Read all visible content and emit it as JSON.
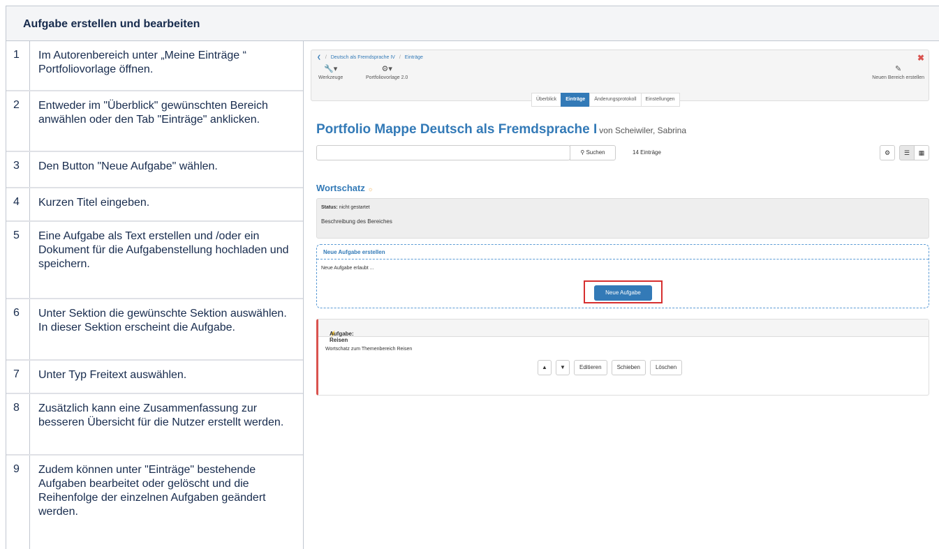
{
  "doc": {
    "heading": "Aufgabe erstellen und bearbeiten",
    "steps": [
      {
        "num": "1",
        "text": "Im Autorenbereich unter „Meine Einträge “ Portfoliovorlage öffnen."
      },
      {
        "num": "2",
        "text": "Entweder im \"Überblick\" gewünschten Bereich anwählen oder den Tab \"Einträge\" anklicken."
      },
      {
        "num": "3",
        "text": "Den Button \"Neue Aufgabe\" wählen."
      },
      {
        "num": "4",
        "text": "Kurzen Titel eingeben."
      },
      {
        "num": "5",
        "text": "Eine Aufgabe als Text erstellen und /oder ein Dokument für die Aufgabenstellung hochladen und speichern."
      },
      {
        "num": "6",
        "text": "Unter Sektion die gewünschte Sektion auswählen. In dieser Sektion erscheint die Aufgabe."
      },
      {
        "num": "7",
        "text": "Unter Typ Freitext auswählen."
      },
      {
        "num": "8",
        "text": "Zusätzlich kann eine Zusammenfassung zur besseren Übersicht für die Nutzer erstellt werden."
      },
      {
        "num": "9",
        "text": "Zudem können unter \"Einträge\" bestehende Aufgaben bearbeitet oder gelöscht und die Reihenfolge der einzelnen Aufgaben geändert werden."
      }
    ]
  },
  "app": {
    "breadcrumb": [
      "Deutsch als Fremdsprache IV",
      "Einträge"
    ],
    "tools": {
      "werkzeuge": "Werkzeuge",
      "vorlage": "Portfoliovorlage 2.0",
      "new_area": "Neuen Bereich erstellen"
    },
    "tabs": [
      "Überblick",
      "Einträge",
      "Änderungsprotokoll",
      "Einstellungen"
    ],
    "title": "Portfolio Mappe Deutsch als Fremdsprache I",
    "author": "von Scheiwiler, Sabrina",
    "search": {
      "value": "",
      "button": "Suchen"
    },
    "count": "14 Einträge",
    "section": {
      "name": "Wortschatz",
      "status_label": "Status:",
      "status_value": "nicht gestartet",
      "description": "Beschreibung des Bereiches"
    },
    "new_task": {
      "header": "Neue Aufgabe erstellen",
      "body": "Neue Aufgabe erlaubt ...",
      "button": "Neue Aufgabe"
    },
    "task": {
      "header": "Aufgabe: Reisen",
      "description": "Wortschatz zum Themenbereich Reisen",
      "edit": "Editieren",
      "move": "Schieben",
      "delete": "Löschen"
    },
    "colors": {
      "accent": "#337ab7",
      "highlight": "#d62f2f"
    }
  }
}
